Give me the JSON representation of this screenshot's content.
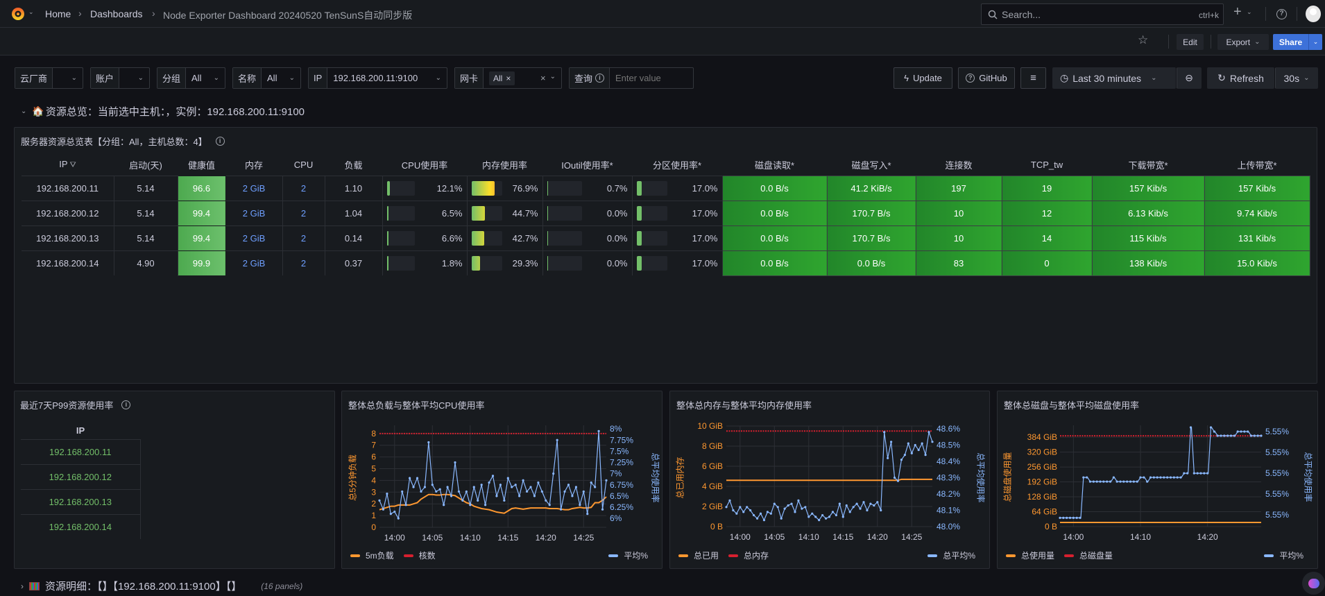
{
  "topnav": {
    "breadcrumb": [
      "Home",
      "Dashboards",
      "Node Exporter Dashboard 20240520 TenSunS自动同步版"
    ],
    "search_placeholder": "Search...",
    "search_shortcut": "ctrl+k",
    "icons": {
      "logo": "grafana-logo",
      "add": "plus-icon",
      "help": "help-icon",
      "avatar": "user-avatar"
    }
  },
  "subbar": {
    "edit": "Edit",
    "export": "Export",
    "share": "Share"
  },
  "variables": [
    {
      "label": "云厂商",
      "value": ""
    },
    {
      "label": "账户",
      "value": ""
    },
    {
      "label": "分组",
      "value": "All"
    },
    {
      "label": "名称",
      "value": "All"
    },
    {
      "label": "IP",
      "value": "192.168.200.11:9100"
    },
    {
      "label": "网卡",
      "value": "All"
    },
    {
      "label": "查询",
      "placeholder": "Enter value"
    }
  ],
  "toolbar": {
    "update": "Update",
    "github": "GitHub",
    "time_range": "Last 30 minutes",
    "refresh": "Refresh",
    "interval": "30s"
  },
  "section1": {
    "title": "资源总览：当前选中主机：，实例：192.168.200.11:9100"
  },
  "overview_table": {
    "title": "服务器资源总览表【分组：All，主机总数：4】",
    "columns": [
      "IP",
      "启动(天)",
      "健康值",
      "内存",
      "CPU",
      "负载",
      "CPU使用率",
      "内存使用率",
      "IOutil使用率*",
      "分区使用率*",
      "磁盘读取*",
      "磁盘写入*",
      "连接数",
      "TCP_tw",
      "下载带宽*",
      "上传带宽*"
    ],
    "rows": [
      [
        "192.168.200.11",
        "5.14",
        "96.6",
        "2 GiB",
        "2",
        "1.10",
        "12.1%",
        "76.9%",
        "0.7%",
        "17.0%",
        "0.0 B/s",
        "41.2 KiB/s",
        "197",
        "19",
        "157 Kib/s",
        "157 Kib/s"
      ],
      [
        "192.168.200.12",
        "5.14",
        "99.4",
        "2 GiB",
        "2",
        "1.04",
        "6.5%",
        "44.7%",
        "0.0%",
        "17.0%",
        "0.0 B/s",
        "170.7 B/s",
        "10",
        "12",
        "6.13 Kib/s",
        "9.74 Kib/s"
      ],
      [
        "192.168.200.13",
        "5.14",
        "99.4",
        "2 GiB",
        "2",
        "0.14",
        "6.6%",
        "42.7%",
        "0.0%",
        "17.0%",
        "0.0 B/s",
        "170.7 B/s",
        "10",
        "14",
        "115 Kib/s",
        "131 Kib/s"
      ],
      [
        "192.168.200.14",
        "4.90",
        "99.9",
        "2 GiB",
        "2",
        "0.37",
        "1.8%",
        "29.3%",
        "0.0%",
        "17.0%",
        "0.0 B/s",
        "0.0 B/s",
        "83",
        "0",
        "138 Kib/s",
        "15.0 Kib/s"
      ]
    ]
  },
  "p99_panel": {
    "title": "最近7天P99资源使用率",
    "column": "IP",
    "rows": [
      "192.168.200.11",
      "192.168.200.12",
      "192.168.200.13",
      "192.168.200.14"
    ]
  },
  "section2": {
    "title": "资源明细：【】【192.168.200.11:9100】【】",
    "count": "(16 panels)"
  },
  "colors": {
    "orange": "#ff9830",
    "red": "#d6202f",
    "blue": "#8ab8ff",
    "green": "#73bf69",
    "accent": "#3d71d9"
  },
  "chart_data": [
    {
      "type": "line",
      "title": "整体总负载与整体平均CPU使用率",
      "ylabel": "总5分钟负载",
      "y2label": "总平均使用率",
      "x_range": [
        "13:58:00",
        "14:28:00"
      ],
      "ylim": [
        0,
        8.7
      ],
      "y2lim": [
        5.8,
        8.08
      ],
      "x_ticks": [
        "14:00",
        "14:05",
        "14:10",
        "14:15",
        "14:20",
        "14:25"
      ],
      "y_ticks": [
        {
          "v": 0,
          "l": "0"
        },
        {
          "v": 1,
          "l": "1"
        },
        {
          "v": 2,
          "l": "2"
        },
        {
          "v": 3,
          "l": "3"
        },
        {
          "v": 4,
          "l": "4"
        },
        {
          "v": 5,
          "l": "5"
        },
        {
          "v": 6,
          "l": "6"
        },
        {
          "v": 7,
          "l": "7"
        },
        {
          "v": 8,
          "l": "8"
        }
      ],
      "y2_ticks": [
        {
          "v": 6,
          "l": "6%"
        },
        {
          "v": 6.25,
          "l": "6.25%"
        },
        {
          "v": 6.5,
          "l": "6.5%"
        },
        {
          "v": 6.75,
          "l": "6.75%"
        },
        {
          "v": 7,
          "l": "7%"
        },
        {
          "v": 7.25,
          "l": "7.25%"
        },
        {
          "v": 7.5,
          "l": "7.5%"
        },
        {
          "v": 7.75,
          "l": "7.75%"
        },
        {
          "v": 8,
          "l": "8%"
        }
      ],
      "x": [
        "13:58:00",
        "13:58:30",
        "13:59:00",
        "13:59:30",
        "14:00:00",
        "14:00:30",
        "14:01:00",
        "14:01:30",
        "14:02:00",
        "14:02:30",
        "14:03:00",
        "14:03:30",
        "14:04:00",
        "14:04:30",
        "14:05:00",
        "14:05:30",
        "14:06:00",
        "14:06:30",
        "14:07:00",
        "14:07:30",
        "14:08:00",
        "14:08:30",
        "14:09:00",
        "14:09:30",
        "14:10:00",
        "14:10:30",
        "14:11:00",
        "14:11:30",
        "14:12:00",
        "14:12:30",
        "14:13:00",
        "14:13:30",
        "14:14:00",
        "14:14:30",
        "14:15:00",
        "14:15:30",
        "14:16:00",
        "14:16:30",
        "14:17:00",
        "14:17:30",
        "14:18:00",
        "14:18:30",
        "14:19:00",
        "14:19:30",
        "14:20:00",
        "14:20:30",
        "14:21:00",
        "14:21:30",
        "14:22:00",
        "14:22:30",
        "14:23:00",
        "14:23:30",
        "14:24:00",
        "14:24:30",
        "14:25:00",
        "14:25:30",
        "14:26:00",
        "14:26:30",
        "14:27:00",
        "14:27:30",
        "14:28:00"
      ],
      "series": [
        {
          "name": "5m负载",
          "axis": "left",
          "color": "#ff9830",
          "style": "solid",
          "values": [
            1.5,
            1.6,
            1.7,
            1.8,
            1.8,
            1.9,
            1.9,
            1.9,
            1.9,
            2.0,
            2.1,
            2.4,
            2.6,
            2.8,
            2.8,
            2.75,
            2.75,
            2.8,
            2.8,
            2.75,
            2.7,
            2.5,
            2.3,
            2.1,
            2.0,
            1.8,
            1.7,
            1.6,
            1.55,
            1.5,
            1.4,
            1.3,
            1.25,
            1.2,
            1.4,
            1.6,
            1.65,
            1.6,
            1.55,
            1.6,
            1.65,
            1.65,
            1.65,
            1.65,
            1.65,
            1.6,
            1.6,
            1.6,
            1.55,
            1.5,
            1.5,
            1.6,
            1.65,
            1.7,
            1.65,
            1.65,
            1.7,
            2.1,
            2.1,
            2.3,
            2.6
          ]
        },
        {
          "name": "核数",
          "axis": "left",
          "color": "#d6202f",
          "style": "dotted",
          "constant": 8
        },
        {
          "name": "平均%",
          "axis": "right",
          "color": "#8ab8ff",
          "style": "points",
          "values": [
            6.4,
            6.2,
            6.55,
            6.1,
            6.15,
            6.0,
            6.6,
            6.3,
            6.9,
            6.7,
            6.9,
            6.6,
            6.7,
            7.7,
            6.75,
            6.6,
            6.65,
            6.3,
            6.7,
            6.5,
            7.25,
            6.6,
            6.4,
            6.6,
            6.3,
            6.7,
            6.4,
            6.75,
            6.3,
            6.8,
            6.95,
            6.5,
            6.75,
            6.4,
            6.9,
            6.7,
            6.75,
            6.5,
            6.85,
            6.6,
            6.7,
            6.5,
            6.8,
            6.6,
            6.4,
            6.3,
            7.0,
            7.75,
            6.2,
            6.6,
            6.75,
            6.5,
            6.7,
            6.3,
            6.6,
            6.1,
            6.8,
            6.7,
            7.95,
            6.2,
            6.85
          ]
        }
      ]
    },
    {
      "type": "line",
      "title": "整体总内存与整体平均内存使用率",
      "ylabel": "总已用内存",
      "y2label": "总平均使用率",
      "x_range": [
        "13:58:00",
        "14:28:00"
      ],
      "ylim": [
        0,
        10
      ],
      "y2lim": [
        48.0,
        48.617
      ],
      "x_ticks": [
        "14:00",
        "14:05",
        "14:10",
        "14:15",
        "14:20",
        "14:25"
      ],
      "y_ticks": [
        {
          "v": 0,
          "l": "0 B"
        },
        {
          "v": 2,
          "l": "2 GiB"
        },
        {
          "v": 4,
          "l": "4 GiB"
        },
        {
          "v": 6,
          "l": "6 GiB"
        },
        {
          "v": 8,
          "l": "8 GiB"
        },
        {
          "v": 10,
          "l": "10 GiB"
        }
      ],
      "y2_ticks": [
        {
          "v": 48.0,
          "l": "48.0%"
        },
        {
          "v": 48.1,
          "l": "48.1%"
        },
        {
          "v": 48.2,
          "l": "48.2%"
        },
        {
          "v": 48.3,
          "l": "48.3%"
        },
        {
          "v": 48.4,
          "l": "48.4%"
        },
        {
          "v": 48.5,
          "l": "48.5%"
        },
        {
          "v": 48.6,
          "l": "48.6%"
        }
      ],
      "x": [
        "13:58:00",
        "13:58:30",
        "13:59:00",
        "13:59:30",
        "14:00:00",
        "14:00:30",
        "14:01:00",
        "14:01:30",
        "14:02:00",
        "14:02:30",
        "14:03:00",
        "14:03:30",
        "14:04:00",
        "14:04:30",
        "14:05:00",
        "14:05:30",
        "14:06:00",
        "14:06:30",
        "14:07:00",
        "14:07:30",
        "14:08:00",
        "14:08:30",
        "14:09:00",
        "14:09:30",
        "14:10:00",
        "14:10:30",
        "14:11:00",
        "14:11:30",
        "14:12:00",
        "14:12:30",
        "14:13:00",
        "14:13:30",
        "14:14:00",
        "14:14:30",
        "14:15:00",
        "14:15:30",
        "14:16:00",
        "14:16:30",
        "14:17:00",
        "14:17:30",
        "14:18:00",
        "14:18:30",
        "14:19:00",
        "14:19:30",
        "14:20:00",
        "14:20:30",
        "14:21:00",
        "14:21:30",
        "14:22:00",
        "14:22:30",
        "14:23:00",
        "14:23:30",
        "14:24:00",
        "14:24:30",
        "14:25:00",
        "14:25:30",
        "14:26:00",
        "14:26:30",
        "14:27:00",
        "14:27:30",
        "14:28:00"
      ],
      "series": [
        {
          "name": "总已用",
          "axis": "left",
          "color": "#ff9830",
          "style": "solid",
          "values": [
            4.6,
            4.6,
            4.6,
            4.6,
            4.6,
            4.6,
            4.6,
            4.6,
            4.6,
            4.6,
            4.6,
            4.6,
            4.6,
            4.6,
            4.6,
            4.6,
            4.6,
            4.6,
            4.6,
            4.6,
            4.6,
            4.6,
            4.6,
            4.6,
            4.6,
            4.6,
            4.6,
            4.6,
            4.6,
            4.6,
            4.6,
            4.6,
            4.6,
            4.6,
            4.6,
            4.6,
            4.6,
            4.6,
            4.6,
            4.6,
            4.6,
            4.6,
            4.6,
            4.6,
            4.6,
            4.6,
            4.6,
            4.6,
            4.6,
            4.6,
            4.6,
            4.7,
            4.7,
            4.7,
            4.7,
            4.7,
            4.7,
            4.7,
            4.7,
            4.7,
            4.7
          ]
        },
        {
          "name": "总内存",
          "axis": "left",
          "color": "#d6202f",
          "style": "dotted",
          "constant": 9.5
        },
        {
          "name": "总平均%",
          "axis": "right",
          "color": "#8ab8ff",
          "style": "points",
          "values": [
            48.12,
            48.16,
            48.1,
            48.08,
            48.12,
            48.09,
            48.12,
            48.1,
            48.07,
            48.05,
            48.08,
            48.04,
            48.09,
            48.08,
            48.14,
            48.12,
            48.05,
            48.11,
            48.13,
            48.14,
            48.09,
            48.16,
            48.11,
            48.12,
            48.06,
            48.08,
            48.06,
            48.04,
            48.07,
            48.05,
            48.06,
            48.09,
            48.07,
            48.14,
            48.06,
            48.13,
            48.09,
            48.12,
            48.14,
            48.11,
            48.15,
            48.1,
            48.14,
            48.13,
            48.15,
            48.1,
            48.58,
            48.42,
            48.52,
            48.3,
            48.28,
            48.41,
            48.44,
            48.51,
            48.45,
            48.5,
            48.47,
            48.51,
            48.44,
            48.58,
            48.52
          ]
        }
      ]
    },
    {
      "type": "line",
      "title": "整体总磁盘与整体平均磁盘使用率",
      "ylabel": "总磁盘使用量",
      "y2label": "总平均使用率",
      "x_range": [
        "13:58:00",
        "14:28:00"
      ],
      "ylim": [
        0,
        435
      ],
      "y2lim": [
        5.54972,
        5.55215
      ],
      "x_ticks": [
        "14:00",
        "14:10",
        "14:20"
      ],
      "y_ticks": [
        {
          "v": 0,
          "l": "0 B"
        },
        {
          "v": 64,
          "l": "64 GiB"
        },
        {
          "v": 128,
          "l": "128 GiB"
        },
        {
          "v": 192,
          "l": "192 GiB"
        },
        {
          "v": 256,
          "l": "256 GiB"
        },
        {
          "v": 320,
          "l": "320 GiB"
        },
        {
          "v": 384,
          "l": "384 GiB"
        }
      ],
      "y2_ticks": [
        {
          "v": 5.55,
          "l": "5.55%"
        },
        {
          "v": 5.5505,
          "l": "5.55%"
        },
        {
          "v": 5.551,
          "l": "5.55%"
        },
        {
          "v": 5.5515,
          "l": "5.55%"
        },
        {
          "v": 5.552,
          "l": "5.55%"
        }
      ],
      "x": [
        "13:58:00",
        "13:58:30",
        "13:59:00",
        "13:59:30",
        "14:00:00",
        "14:00:30",
        "14:01:00",
        "14:01:30",
        "14:02:00",
        "14:02:30",
        "14:03:00",
        "14:03:30",
        "14:04:00",
        "14:04:30",
        "14:05:00",
        "14:05:30",
        "14:06:00",
        "14:06:30",
        "14:07:00",
        "14:07:30",
        "14:08:00",
        "14:08:30",
        "14:09:00",
        "14:09:30",
        "14:10:00",
        "14:10:30",
        "14:11:00",
        "14:11:30",
        "14:12:00",
        "14:12:30",
        "14:13:00",
        "14:13:30",
        "14:14:00",
        "14:14:30",
        "14:15:00",
        "14:15:30",
        "14:16:00",
        "14:16:30",
        "14:17:00",
        "14:17:30",
        "14:18:00",
        "14:18:30",
        "14:19:00",
        "14:19:30",
        "14:20:00",
        "14:20:30",
        "14:21:00",
        "14:21:30",
        "14:22:00",
        "14:22:30",
        "14:23:00",
        "14:23:30",
        "14:24:00",
        "14:24:30",
        "14:25:00",
        "14:25:30",
        "14:26:00",
        "14:26:30",
        "14:27:00",
        "14:27:30",
        "14:28:00"
      ],
      "series": [
        {
          "name": "总使用量",
          "axis": "left",
          "color": "#ff9830",
          "style": "solid",
          "constant": 18
        },
        {
          "name": "总磁盘量",
          "axis": "left",
          "color": "#d6202f",
          "style": "dotted",
          "constant": 390
        },
        {
          "name": "平均%",
          "axis": "right",
          "color": "#8ab8ff",
          "style": "points",
          "values": [
            5.54993,
            5.54993,
            5.54993,
            5.54993,
            5.54993,
            5.54993,
            5.54993,
            5.5509,
            5.5509,
            5.5508,
            5.5508,
            5.5508,
            5.5508,
            5.5508,
            5.5508,
            5.5508,
            5.5509,
            5.5508,
            5.5508,
            5.5508,
            5.5508,
            5.5508,
            5.5508,
            5.5508,
            5.5509,
            5.5509,
            5.5508,
            5.5509,
            5.5509,
            5.5509,
            5.5509,
            5.5509,
            5.5509,
            5.5509,
            5.5509,
            5.5509,
            5.5509,
            5.551,
            5.551,
            5.5521,
            5.551,
            5.551,
            5.551,
            5.551,
            5.551,
            5.5521,
            5.552,
            5.5519,
            5.5519,
            5.5519,
            5.5519,
            5.5519,
            5.5519,
            5.552,
            5.552,
            5.552,
            5.552,
            5.5519,
            5.5519,
            5.5519,
            5.5519
          ]
        }
      ]
    }
  ]
}
